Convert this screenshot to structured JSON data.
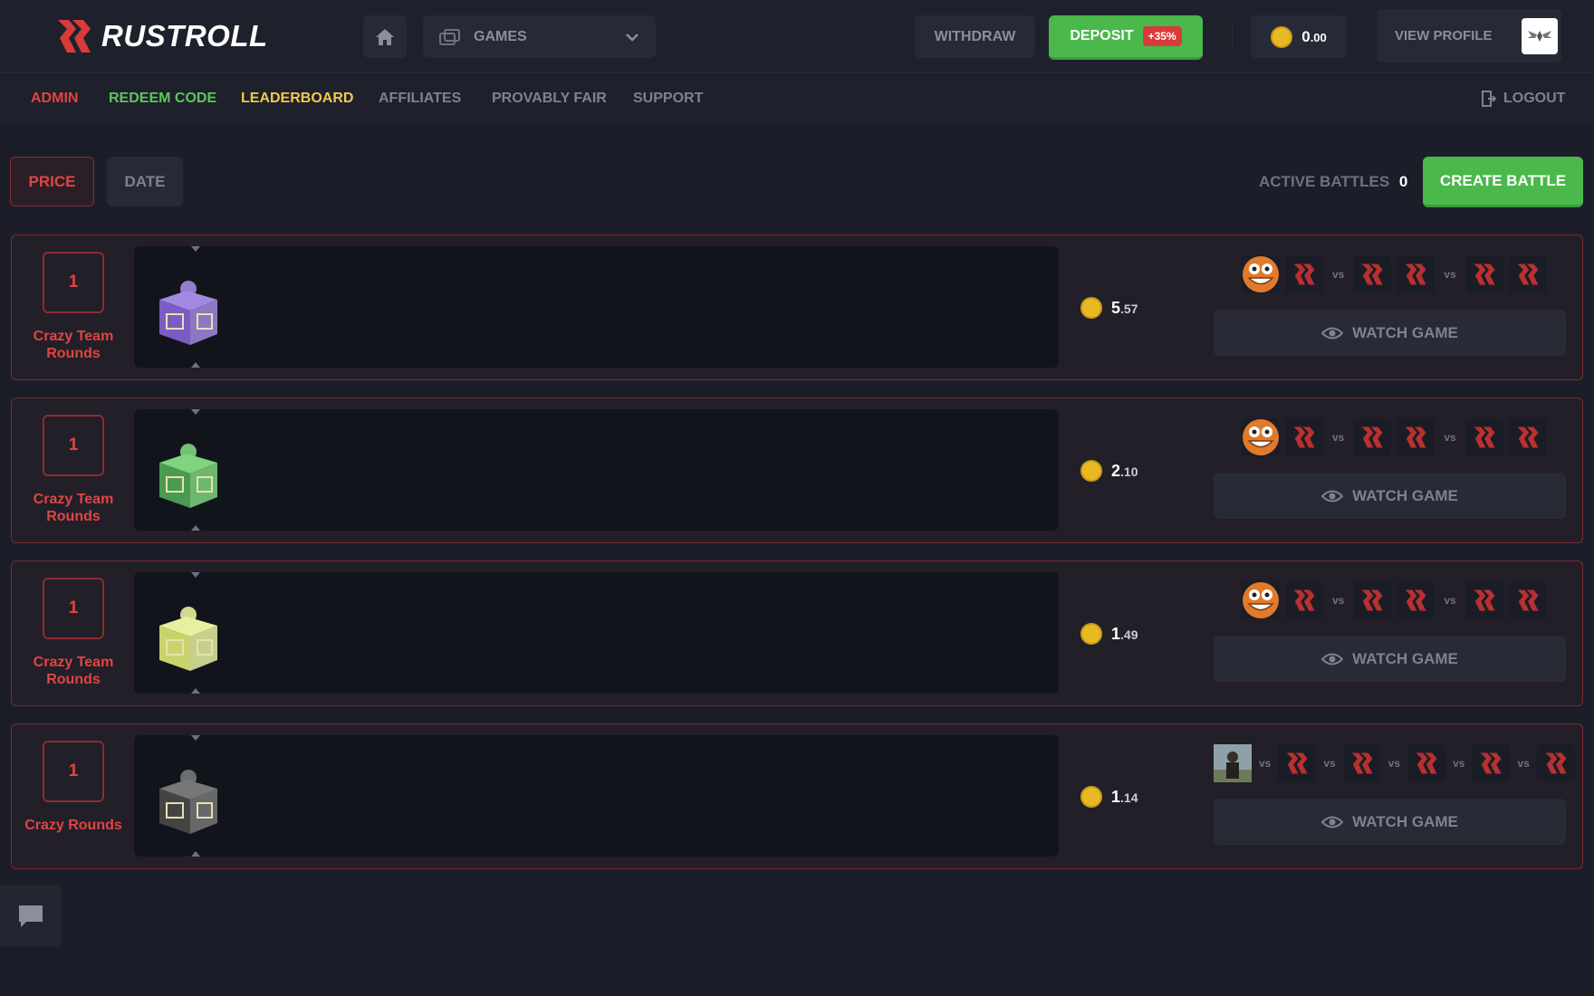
{
  "header": {
    "brand": "RUSTROLL",
    "games_label": "GAMES",
    "withdraw_label": "WITHDRAW",
    "deposit_label": "DEPOSIT",
    "deposit_bonus": "+35%",
    "balance_main": "0",
    "balance_decimal": ".00",
    "profile_label": "VIEW PROFILE"
  },
  "nav": {
    "items": [
      "ADMIN",
      "REDEEM CODE",
      "LEADERBOARD",
      "AFFILIATES",
      "PROVABLY FAIR",
      "SUPPORT"
    ],
    "logout": "LOGOUT"
  },
  "filters": {
    "price": "PRICE",
    "date": "DATE"
  },
  "battles_header": {
    "active_label": "ACTIVE BATTLES",
    "active_count": "0",
    "create_label": "CREATE BATTLE"
  },
  "battles": [
    {
      "rounds": "1",
      "mode": "Crazy Team Rounds",
      "price_main": "5",
      "price_dec": ".57",
      "watch": "WATCH GAME",
      "case_color": "purple"
    },
    {
      "rounds": "1",
      "mode": "Crazy Team Rounds",
      "price_main": "2",
      "price_dec": ".10",
      "watch": "WATCH GAME",
      "case_color": "green"
    },
    {
      "rounds": "1",
      "mode": "Crazy Team Rounds",
      "price_main": "1",
      "price_dec": ".49",
      "watch": "WATCH GAME",
      "case_color": "lime"
    },
    {
      "rounds": "1",
      "mode": "Crazy Rounds",
      "price_main": "1",
      "price_dec": ".14",
      "watch": "WATCH GAME",
      "case_color": "gray"
    }
  ],
  "vs_label": "vs",
  "colors": {
    "accent_red": "#e04444",
    "green": "#4ab84a",
    "gold": "#f2c94c",
    "coin": "#e8b923"
  }
}
